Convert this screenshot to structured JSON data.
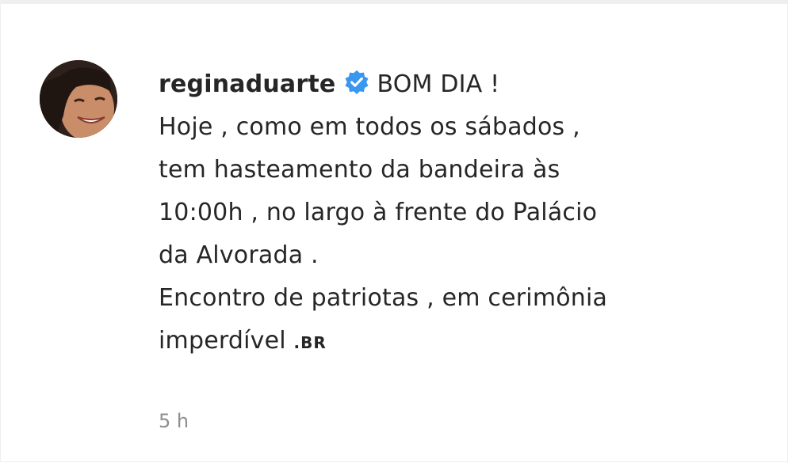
{
  "comment": {
    "username": "reginaduarte",
    "verified_icon": "verified-badge-icon",
    "verified_color": "#3897f0",
    "first_line_text": "BOM DIA !",
    "lines": [
      "Hoje , como em todos os sábados ,",
      "tem hasteamento da bandeira às",
      "10:00h , no largo à frente do Palácio",
      "da Alvorada .",
      "Encontro de patriotas , em cerimônia"
    ],
    "last_line_text": "imperdível",
    "last_line_emoji": ".BR",
    "timestamp": "5 h"
  }
}
